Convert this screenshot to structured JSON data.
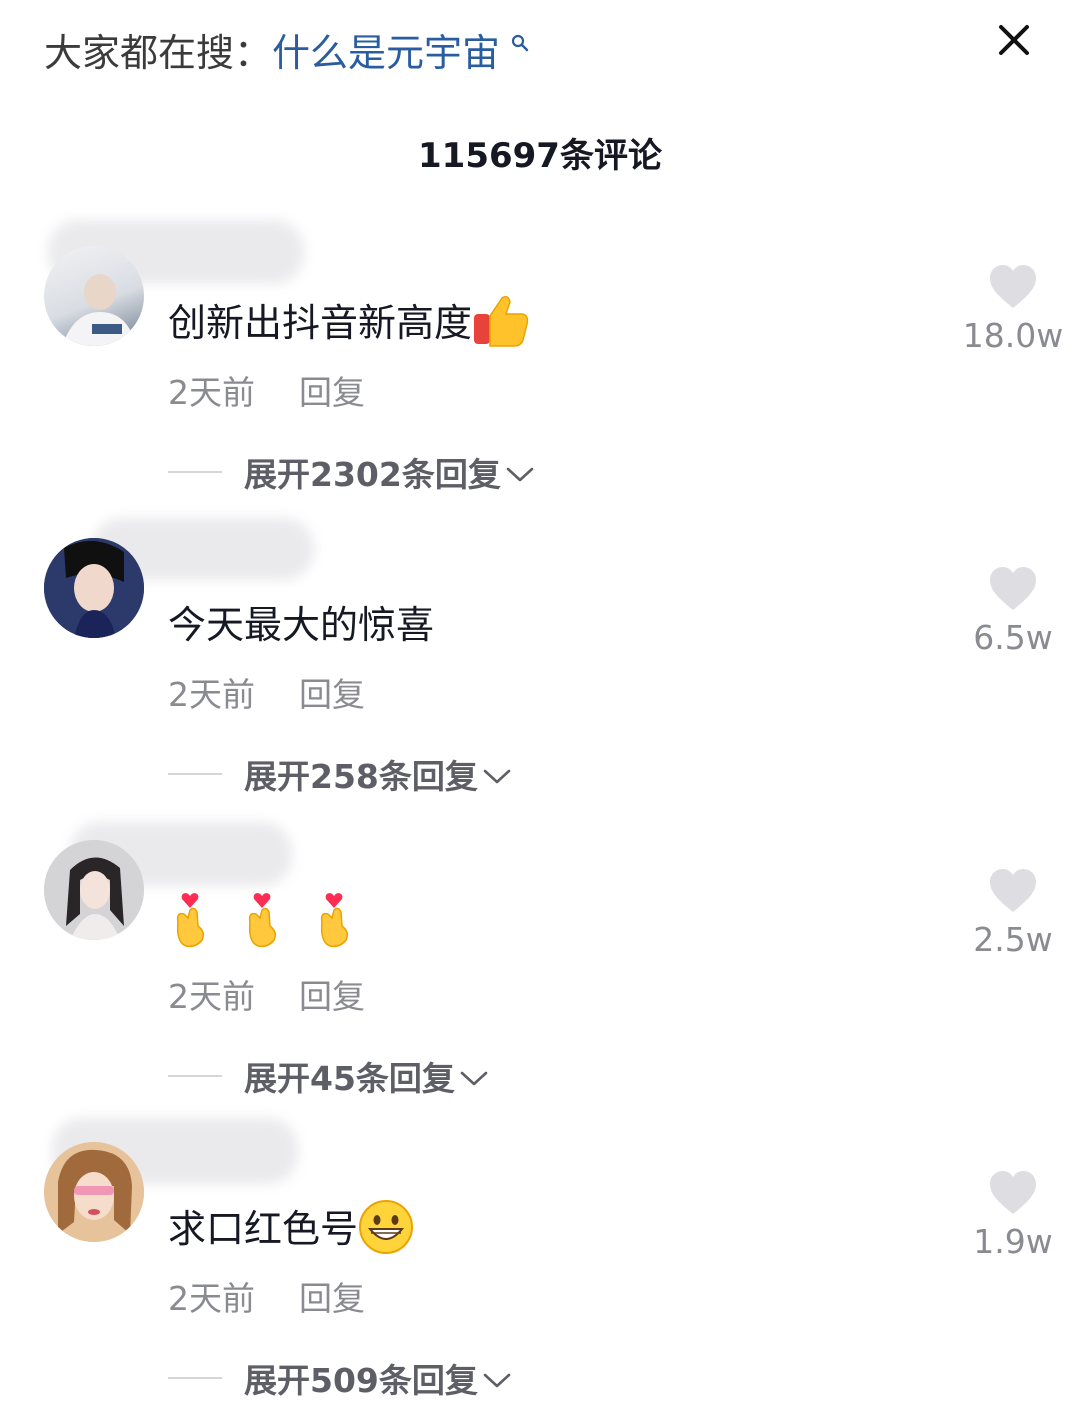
{
  "header": {
    "search_prefix": "大家都在搜：",
    "search_query": "什么是元宇宙",
    "search_icon": "search-icon",
    "close_icon": "close-icon",
    "comment_count": "115697条评论"
  },
  "comments": [
    {
      "text": "创新出抖音新高度",
      "emoji": "thumbs-up-icon",
      "time": "2天前",
      "reply_label": "回复",
      "expand_label": "展开2302条回复",
      "likes": "18.0w"
    },
    {
      "text": "今天最大的惊喜",
      "time": "2天前",
      "reply_label": "回复",
      "expand_label": "展开258条回复",
      "likes": "6.5w"
    },
    {
      "text": "",
      "emoji": "finger-heart-icon",
      "emoji_count": 3,
      "time": "2天前",
      "reply_label": "回复",
      "expand_label": "展开45条回复",
      "likes": "2.5w"
    },
    {
      "text": "求口红色号",
      "emoji": "grinning-face-icon",
      "time": "2天前",
      "reply_label": "回复",
      "expand_label": "展开509条回复",
      "likes": "1.9w"
    }
  ],
  "colors": {
    "query_link": "#2a5d9f",
    "meta_gray": "#8a8b91",
    "heart_gray": "#dedee2"
  }
}
